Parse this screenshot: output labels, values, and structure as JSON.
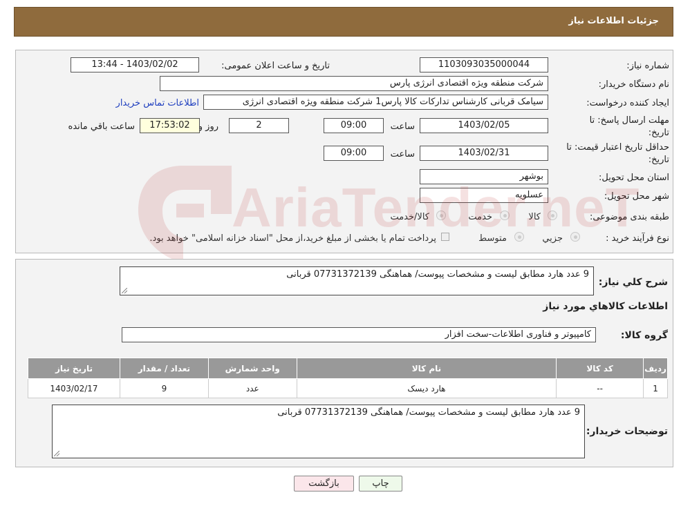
{
  "header": {
    "title": "جزئیات اطلاعات نیاز"
  },
  "form": {
    "need_number_label": "شماره نیاز:",
    "need_number": "1103093035000044",
    "announce_label": "تاریخ و ساعت اعلان عمومی:",
    "announce_value": "1403/02/02 - 13:44",
    "buyer_org_label": "نام دستگاه خریدار:",
    "buyer_org": "شرکت منطقه ویژه اقتصادی انرژی پارس",
    "creator_label": "ایجاد کننده درخواست:",
    "creator": "سیامک قربانی کارشناس تدارکات کالا پارس1 شرکت منطقه ویژه اقتصادی انرژی",
    "contact_link": "اطلاعات تماس خریدار",
    "deadline_label": "مهلت ارسال پاسخ: تا تاریخ:",
    "deadline_date": "1403/02/05",
    "time_label": "ساعت",
    "deadline_time": "09:00",
    "days_value": "2",
    "days_label": "روز و",
    "remaining_time": "17:53:02",
    "remaining_label": "ساعت باقي مانده",
    "validity_label": "حداقل تاریخ اعتبار قیمت: تا تاریخ:",
    "validity_date": "1403/02/31",
    "validity_time": "09:00",
    "province_label": "استان محل تحویل:",
    "province": "بوشهر",
    "city_label": "شهر محل تحویل:",
    "city": "عسلویه",
    "category_label": "طبقه بندی موضوعی:",
    "category_options": [
      "کالا",
      "خدمت",
      "کالا/خدمت"
    ],
    "process_label": "نوع فرآیند خرید :",
    "process_options": [
      "جزیي",
      "متوسط"
    ],
    "process_note": "پرداخت تمام یا بخشی از مبلغ خرید،از محل \"اسناد خزانه اسلامی\" خواهد بود."
  },
  "details": {
    "summary_label": "شرح كلي نياز:",
    "summary": "9 عدد هارد مطابق لیست و مشخصات پیوست/ هماهنگی 07731372139 قربانی",
    "items_title": "اطلاعات کالاهاي مورد نياز",
    "group_label": "گروه کالا:",
    "group": "کامپیوتر و فناوری اطلاعات-سخت افزار",
    "table_headers": [
      "رديف",
      "کد کالا",
      "نام کالا",
      "واحد شمارش",
      "تعداد / مقدار",
      "تاریخ نیاز"
    ],
    "rows": [
      [
        "1",
        "--",
        "هارد دیسک",
        "عدد",
        "9",
        "1403/02/17"
      ]
    ],
    "buyer_notes_label": "توضیحات خریدار:",
    "buyer_notes": "9 عدد هارد مطابق لیست و مشخصات پیوست/ هماهنگی 07731372139 قربانی"
  },
  "buttons": {
    "print": "چاپ",
    "back": "بازگشت"
  },
  "watermark": {
    "text": "AriaTender.neT",
    "color": "#b22222"
  }
}
